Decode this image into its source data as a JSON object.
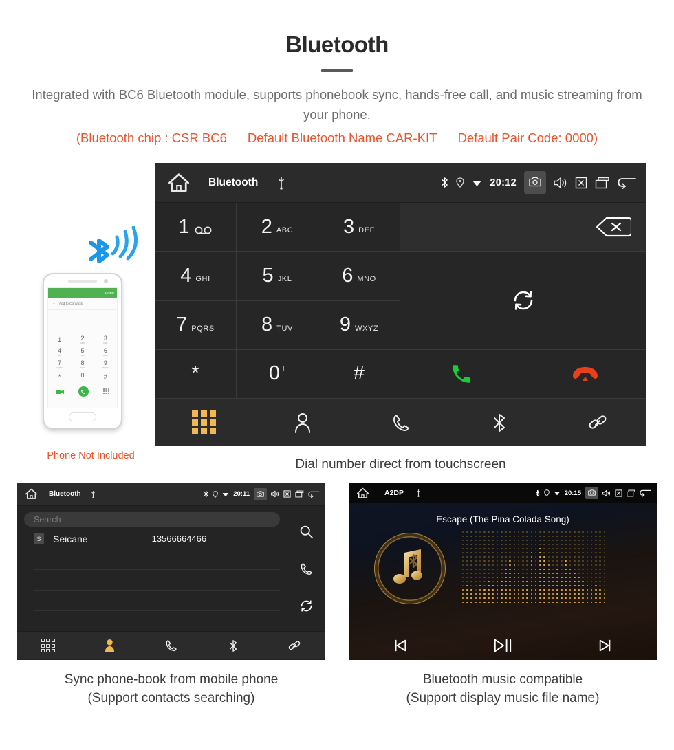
{
  "header": {
    "title": "Bluetooth",
    "subtitle": "Integrated with BC6 Bluetooth module, supports phonebook sync, hands-free call, and music streaming from your phone.",
    "specs": [
      "(Bluetooth chip : CSR BC6",
      "Default Bluetooth Name CAR-KIT",
      "Default Pair Code: 0000)"
    ]
  },
  "dialer": {
    "status": {
      "title": "Bluetooth",
      "clock": "20:12",
      "icons": [
        "home-icon",
        "usb-icon",
        "bluetooth-icon",
        "location-icon",
        "wifi-icon",
        "camera-icon",
        "volume-icon",
        "mute-icon",
        "recents-icon",
        "back-icon"
      ]
    },
    "keys": [
      {
        "digit": "1",
        "letters": "",
        "voicemail": true
      },
      {
        "digit": "2",
        "letters": "ABC"
      },
      {
        "digit": "3",
        "letters": "DEF"
      },
      {
        "digit": "4",
        "letters": "GHI"
      },
      {
        "digit": "5",
        "letters": "JKL"
      },
      {
        "digit": "6",
        "letters": "MNO"
      },
      {
        "digit": "7",
        "letters": "PQRS"
      },
      {
        "digit": "8",
        "letters": "TUV"
      },
      {
        "digit": "9",
        "letters": "WXYZ"
      },
      {
        "digit": "*",
        "letters": ""
      },
      {
        "digit": "0",
        "letters": "",
        "plus": "+"
      },
      {
        "digit": "#",
        "letters": ""
      }
    ],
    "number_display": "",
    "nav": [
      "dialpad-icon",
      "contacts-icon",
      "calllog-icon",
      "bluetooth-icon",
      "link-icon"
    ],
    "active_nav": "dialpad-icon",
    "caption": "Dial number direct from touchscreen"
  },
  "phone_mock": {
    "bar_back": "←",
    "bar_more": "MORE",
    "add_contacts": "Add to Contacts",
    "keys": [
      {
        "n": "1",
        "s": ""
      },
      {
        "n": "2",
        "s": "ABC"
      },
      {
        "n": "3",
        "s": "DEF"
      },
      {
        "n": "4",
        "s": "GHI"
      },
      {
        "n": "5",
        "s": "JKL"
      },
      {
        "n": "6",
        "s": "MNO"
      },
      {
        "n": "7",
        "s": "PQRS"
      },
      {
        "n": "8",
        "s": "TUV"
      },
      {
        "n": "9",
        "s": "WXYZ"
      },
      {
        "n": "*",
        "s": ""
      },
      {
        "n": "0",
        "s": "+"
      },
      {
        "n": "#",
        "s": ""
      }
    ],
    "not_included": "Phone Not Included"
  },
  "phonebook": {
    "status": {
      "title": "Bluetooth",
      "clock": "20:11"
    },
    "search_placeholder": "Search",
    "contact": {
      "badge": "S",
      "name": "Seicane",
      "number": "13566664466"
    },
    "side_icons": [
      "search-icon",
      "call-icon",
      "sync-icon"
    ],
    "nav": [
      "dialpad-icon",
      "contacts-icon",
      "calllog-icon",
      "bluetooth-icon",
      "link-icon"
    ],
    "active_nav": "contacts-icon",
    "caption_line1": "Sync phone-book from mobile phone",
    "caption_line2": "(Support contacts searching)"
  },
  "music": {
    "status": {
      "title": "A2DP",
      "clock": "20:15"
    },
    "song": "Escape (The Pina Colada Song)",
    "controls": [
      "previous-icon",
      "play-pause-icon",
      "next-icon"
    ],
    "caption_line1": "Bluetooth music compatible",
    "caption_line2": "(Support display music file name)"
  },
  "colors": {
    "accent_orange": "#e8552d",
    "active_gold": "#f0b752",
    "call_green": "#19cc3c",
    "hangup_red": "#e8401a"
  }
}
